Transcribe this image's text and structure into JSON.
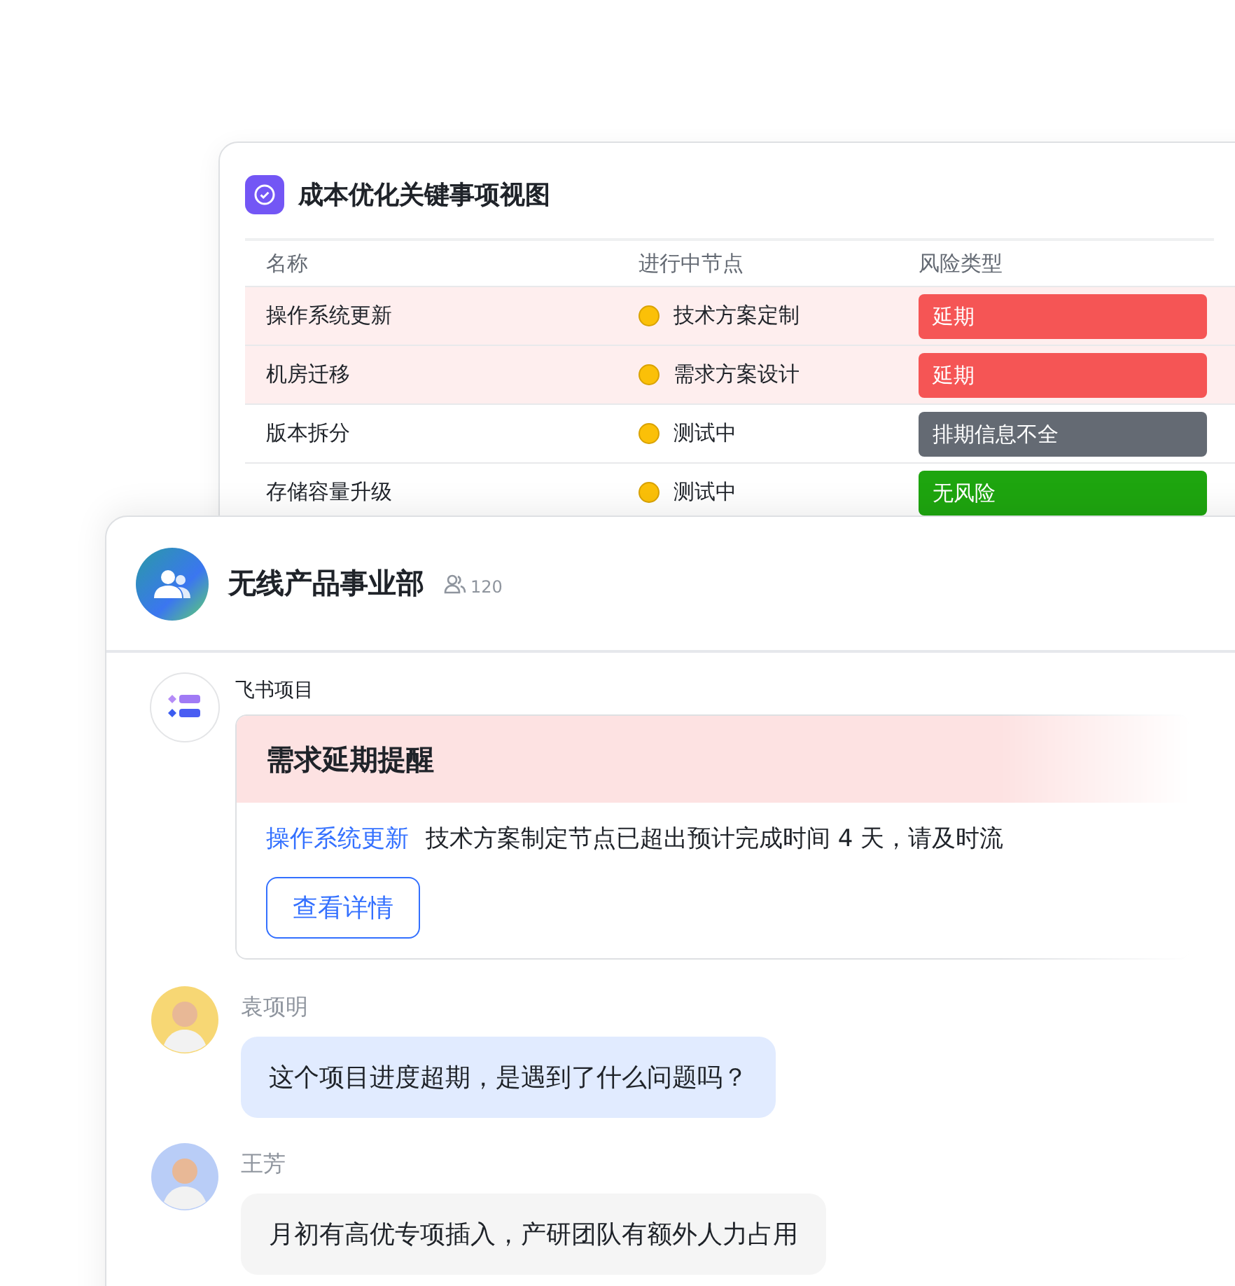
{
  "view_card": {
    "title": "成本优化关键事项视图",
    "columns": [
      "名称",
      "进行中节点",
      "风险类型"
    ],
    "rows": [
      {
        "name": "操作系统更新",
        "node": "技术方案定制",
        "risk": {
          "label": "延期",
          "color": "#f55555"
        },
        "flagged": true
      },
      {
        "name": "机房迁移",
        "node": "需求方案设计",
        "risk": {
          "label": "延期",
          "color": "#f55555"
        },
        "flagged": true
      },
      {
        "name": "版本拆分",
        "node": "测试中",
        "risk": {
          "label": "排期信息不全",
          "color": "#646a73"
        },
        "flagged": false
      },
      {
        "name": "存储容量升级",
        "node": "测试中",
        "risk": {
          "label": "无风险",
          "color": "#1ea50f"
        },
        "flagged": false
      }
    ]
  },
  "chat": {
    "group_name": "无线产品事业部",
    "member_count": "120",
    "bot_message": {
      "sender": "飞书项目",
      "card_title": "需求延期提醒",
      "link": "操作系统更新",
      "text": "技术方案制定节点已超出预计完成时间 4 天，请及时流",
      "button": "查看详情"
    },
    "messages": [
      {
        "sender": "袁项明",
        "text": "这个项目进度超期，是遇到了什么问题吗？",
        "kind": "question"
      },
      {
        "sender": "王芳",
        "text": "月初有高优专项插入，产研团队有额外人力占用",
        "kind": "reply"
      }
    ]
  }
}
